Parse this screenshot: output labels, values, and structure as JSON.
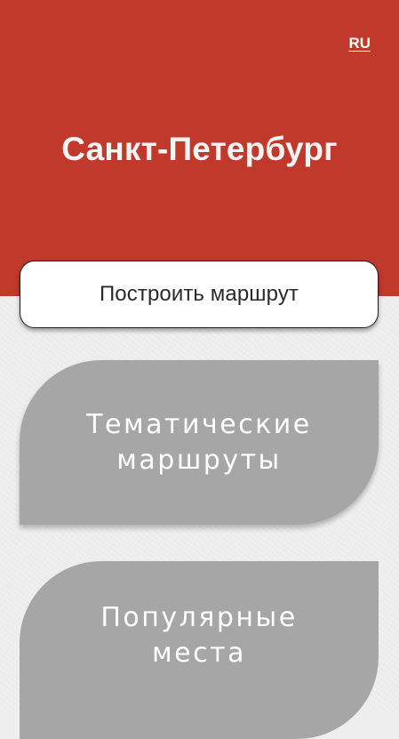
{
  "app": {
    "language_toggle": "RU",
    "city_title": "Санкт-Петербург"
  },
  "actions": {
    "build_route_label": "Построить маршрут"
  },
  "menu": {
    "items": [
      {
        "label": "Тематические\nмаршруты"
      },
      {
        "label": "Популярные\nместа"
      }
    ]
  },
  "colors": {
    "header_background": "#c0392b",
    "page_background": "#efefef",
    "card_background": "#a6a6a6",
    "button_background": "#ffffff"
  }
}
